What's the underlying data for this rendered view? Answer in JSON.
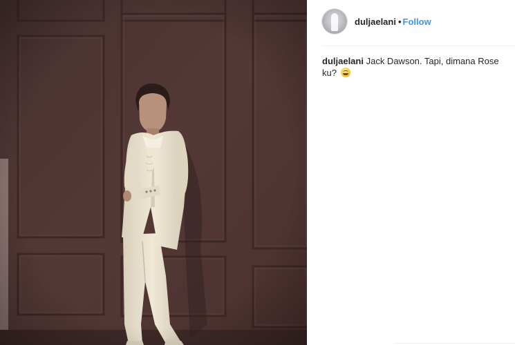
{
  "post": {
    "image_alt": "Photo by duljaelani",
    "colors": {
      "wall": "#4e3533",
      "panel_line": "#3a2624",
      "suit": "#e9e2cf",
      "follow": "#3897f0",
      "text": "#262626"
    }
  },
  "header": {
    "avatar_icon": "user-avatar",
    "username": "duljaelani",
    "separator": "•",
    "follow_label": "Follow"
  },
  "caption": {
    "username": "duljaelani",
    "text": "Jack Dawson. Tapi, dimana Rose ku?",
    "emoji_icon": "grinning-sweat-emoji"
  }
}
